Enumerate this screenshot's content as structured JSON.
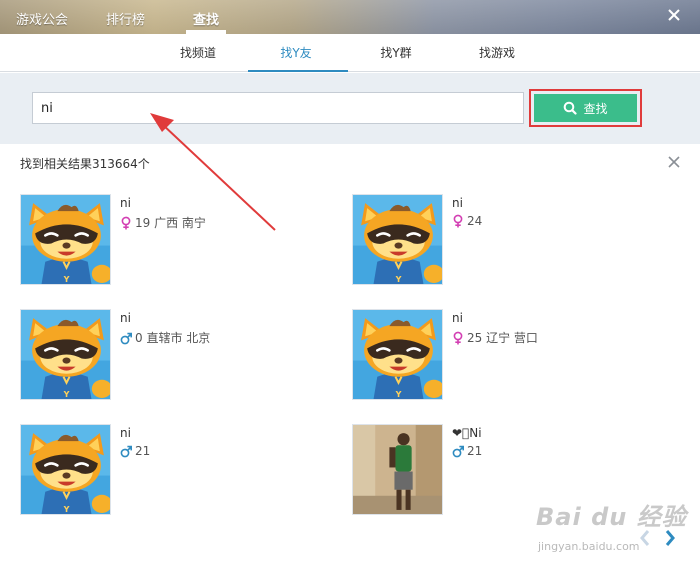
{
  "top_tabs": [
    {
      "label": "游戏公会",
      "active": false
    },
    {
      "label": "排行榜",
      "active": false
    },
    {
      "label": "查找",
      "active": true
    }
  ],
  "sub_tabs": [
    {
      "label": "找频道",
      "active": false
    },
    {
      "label": "找Y友",
      "active": true
    },
    {
      "label": "找Y群",
      "active": false
    },
    {
      "label": "找游戏",
      "active": false
    }
  ],
  "search": {
    "value": "ni",
    "placeholder": "",
    "button_label": "查找",
    "button_icon": "search-icon",
    "button_color": "#3bbd8b",
    "highlight_color": "#e03b3b"
  },
  "results": {
    "count_text": "找到相关结果313664个",
    "users": [
      {
        "name": "ni",
        "gender": "female",
        "info": "19 广西 南宁",
        "avatar": "yy-mascot"
      },
      {
        "name": "ni",
        "gender": "female",
        "info": "24",
        "avatar": "yy-mascot"
      },
      {
        "name": "ni",
        "gender": "male",
        "info": "0 直辖市 北京",
        "avatar": "yy-mascot"
      },
      {
        "name": "ni",
        "gender": "female",
        "info": "25 辽宁 营口",
        "avatar": "yy-mascot"
      },
      {
        "name": "ni",
        "gender": "male",
        "info": "21",
        "avatar": "yy-mascot"
      },
      {
        "name": "❤\u0000Ni",
        "gender": "male",
        "info": "21",
        "avatar": "photo"
      }
    ]
  },
  "watermark": {
    "mark": "Bai du 经验",
    "url": "jingyan.baidu.com"
  },
  "colors": {
    "accent_blue": "#2e8bc0",
    "female": "#d33fb3",
    "male": "#2e8bc0",
    "annotation_red": "#e03b3b"
  }
}
